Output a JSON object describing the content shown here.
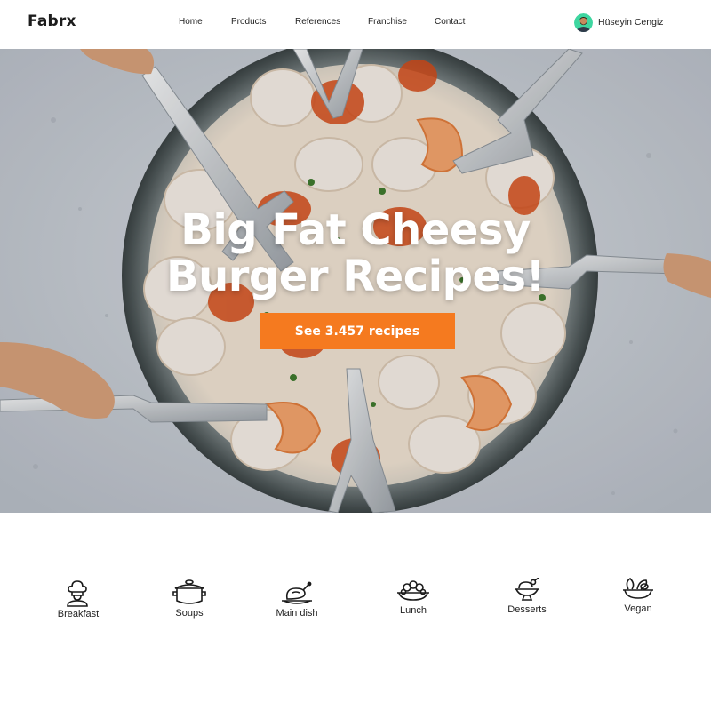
{
  "brand": {
    "logo": "Fabrx",
    "accent_color": "#f57a1f"
  },
  "nav": {
    "items": [
      {
        "label": "Home",
        "active": true
      },
      {
        "label": "Products",
        "active": false
      },
      {
        "label": "References",
        "active": false
      },
      {
        "label": "Franchise",
        "active": false
      },
      {
        "label": "Contact",
        "active": false
      }
    ]
  },
  "user": {
    "name": "Hüseyin Cengiz",
    "avatar_icon": "user-avatar"
  },
  "hero": {
    "title_line1": "Big Fat Cheesy",
    "title_line2": "Burger Recipes!",
    "cta_label": "See 3.457 recipes",
    "image": "overhead plate of scallops and shrimp with forks"
  },
  "categories": [
    {
      "label": "Breakfast",
      "icon": "chef-icon"
    },
    {
      "label": "Soups",
      "icon": "pot-icon"
    },
    {
      "label": "Main dish",
      "icon": "roast-chicken-icon"
    },
    {
      "label": "Lunch",
      "icon": "lunch-bowl-icon"
    },
    {
      "label": "Desserts",
      "icon": "dessert-icon"
    },
    {
      "label": "Vegan",
      "icon": "vegan-bowl-icon"
    }
  ]
}
